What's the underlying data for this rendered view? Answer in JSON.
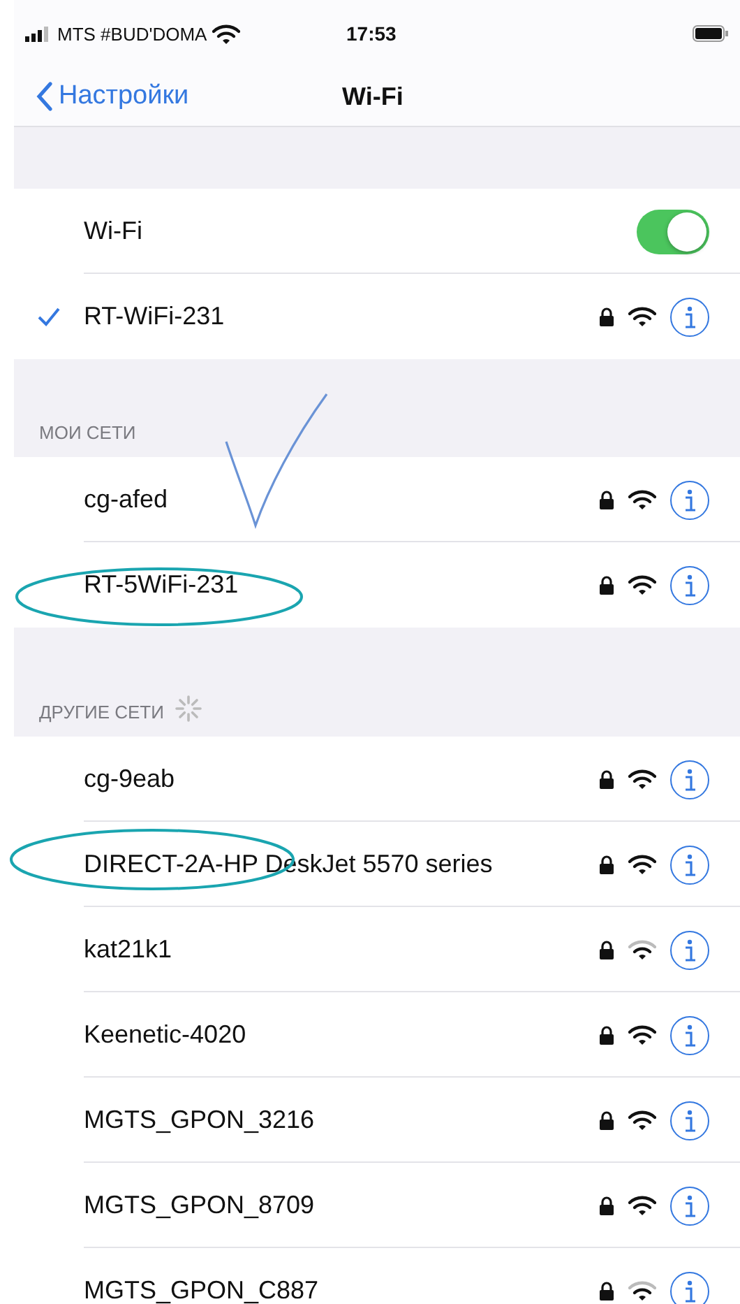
{
  "status_bar": {
    "carrier": "MTS #BUD'DOMA",
    "time": "17:53"
  },
  "nav": {
    "back": "Настройки",
    "title": "Wi-Fi"
  },
  "wifi_toggle": {
    "label": "Wi-Fi",
    "on": true
  },
  "connected": {
    "name": "RT-WiFi-231",
    "selected": true,
    "locked": true,
    "weak_signal": false
  },
  "sections": [
    {
      "header": "МОИ СЕТИ",
      "loading": false,
      "networks": [
        {
          "name": "cg-afed",
          "locked": true,
          "weak_signal": false
        },
        {
          "name": "RT-5WiFi-231",
          "locked": true,
          "weak_signal": false
        }
      ]
    },
    {
      "header": "ДРУГИЕ СЕТИ",
      "loading": true,
      "networks": [
        {
          "name": "cg-9eab",
          "locked": true,
          "weak_signal": false
        },
        {
          "name": "DIRECT-2A-HP DeskJet 5570 series",
          "locked": true,
          "weak_signal": false
        },
        {
          "name": "kat21k1",
          "locked": true,
          "weak_signal": true
        },
        {
          "name": "Keenetic-4020",
          "locked": true,
          "weak_signal": false
        },
        {
          "name": "MGTS_GPON_3216",
          "locked": true,
          "weak_signal": false
        },
        {
          "name": "MGTS_GPON_8709",
          "locked": true,
          "weak_signal": false
        },
        {
          "name": "MGTS_GPON_C887",
          "locked": true,
          "weak_signal": true
        }
      ]
    }
  ]
}
